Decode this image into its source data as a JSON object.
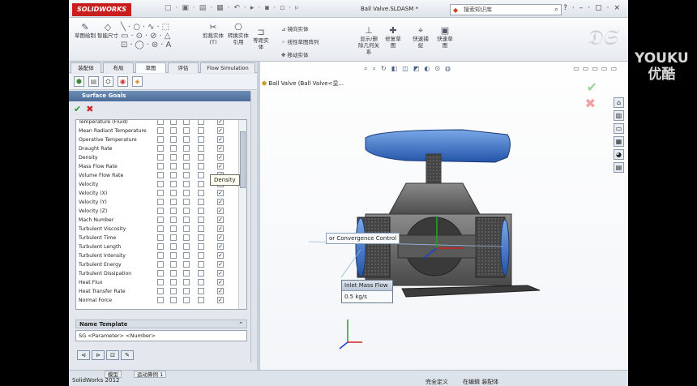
{
  "app": {
    "logo": "SOLIDWORKS",
    "doc_title": "Ball Valve.SLDASM *",
    "search_placeholder": "搜索知识库",
    "status_product": "SolidWorks 2012"
  },
  "ribbon": {
    "big": [
      {
        "label": "草图绘制"
      },
      {
        "label": "智能尺寸"
      },
      {
        "label": "剪裁实体(T)"
      },
      {
        "label": "转换实体引用"
      },
      {
        "label": "等距实体"
      },
      {
        "label": "显示/删除几何关系"
      },
      {
        "label": "修复草图"
      },
      {
        "label": "快速捕捉"
      },
      {
        "label": "快速草图"
      }
    ],
    "small": [
      "镜向实体",
      "线性草图阵列",
      "移动实体"
    ]
  },
  "fm_tabs": [
    "装配体",
    "布局",
    "草图",
    "评估",
    "Flow Simulation"
  ],
  "panel": {
    "title": "Surface Goals",
    "help": "?"
  },
  "goal_rows": [
    {
      "label": "Temperature (Fluid)",
      "c": [
        0,
        0,
        0,
        0,
        1
      ]
    },
    {
      "label": "Mean Radiant Temperature",
      "c": [
        0,
        0,
        0,
        0,
        1
      ]
    },
    {
      "label": "Operative Temperature",
      "c": [
        0,
        0,
        0,
        0,
        1
      ]
    },
    {
      "label": "Draught Rate",
      "c": [
        0,
        0,
        0,
        0,
        1
      ]
    },
    {
      "label": "Density",
      "c": [
        0,
        0,
        0,
        0,
        1
      ]
    },
    {
      "label": "Mass Flow Rate",
      "c": [
        0,
        0,
        0,
        0,
        1
      ]
    },
    {
      "label": "Volume Flow Rate",
      "c": [
        0,
        0,
        0,
        0,
        1
      ]
    },
    {
      "label": "Velocity",
      "c": [
        0,
        0,
        0,
        0,
        1
      ]
    },
    {
      "label": "Velocity (X)",
      "c": [
        0,
        0,
        0,
        0,
        1
      ]
    },
    {
      "label": "Velocity (Y)",
      "c": [
        0,
        0,
        0,
        0,
        1
      ]
    },
    {
      "label": "Velocity (Z)",
      "c": [
        0,
        0,
        0,
        0,
        1
      ]
    },
    {
      "label": "Mach Number",
      "c": [
        0,
        0,
        0,
        0,
        1
      ]
    },
    {
      "label": "Turbulent Viscosity",
      "c": [
        0,
        0,
        0,
        0,
        1
      ]
    },
    {
      "label": "Turbulent Time",
      "c": [
        0,
        0,
        0,
        0,
        1
      ]
    },
    {
      "label": "Turbulent Length",
      "c": [
        0,
        0,
        0,
        0,
        1
      ]
    },
    {
      "label": "Turbulent Intensity",
      "c": [
        0,
        0,
        0,
        0,
        1
      ]
    },
    {
      "label": "Turbulent Energy",
      "c": [
        0,
        0,
        0,
        0,
        1
      ]
    },
    {
      "label": "Turbulent Dissipation",
      "c": [
        0,
        0,
        0,
        0,
        1
      ]
    },
    {
      "label": "Heat Flux",
      "c": [
        0,
        0,
        0,
        0,
        1
      ]
    },
    {
      "label": "Heat Transfer Rate",
      "c": [
        0,
        0,
        0,
        0,
        1
      ]
    },
    {
      "label": "Normal Force",
      "c": [
        0,
        0,
        0,
        0,
        1
      ]
    }
  ],
  "tooltip": "Density",
  "name_template": {
    "header": "Name Template",
    "value": "SG <Parameter> <Number>"
  },
  "graphics": {
    "tree_label": "Ball Valve  (Ball Valve<显...",
    "callout_convergence": "or Convergence Control",
    "callout_inlet_title": "Inlet Mass Flow",
    "callout_inlet_value": "0.5 kg/s"
  },
  "status": {
    "tab1": "模型",
    "tab2": "运动算例 1",
    "under_defined": "完全定义",
    "editing": "在编辑 装配体"
  },
  "watermark": {
    "line1": "YOUKU",
    "line2": "优酷"
  }
}
